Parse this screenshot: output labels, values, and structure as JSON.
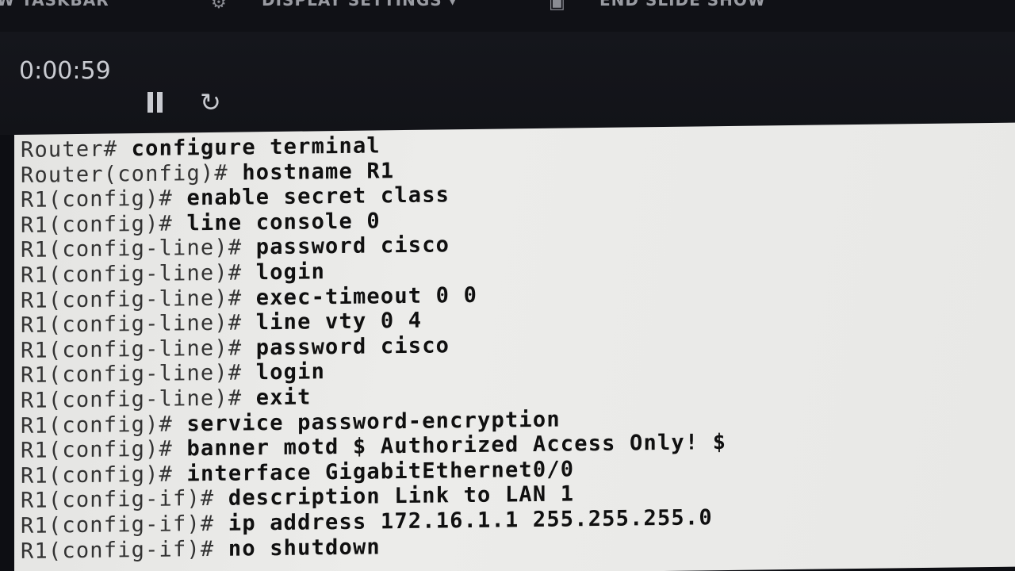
{
  "toolbar": {
    "items": [
      {
        "label": "W TASKBAR"
      },
      {
        "label": "DISPLAY SETTINGS ▾"
      },
      {
        "label": "END SLIDE SHOW"
      }
    ]
  },
  "presenter": {
    "timer": "0:00:59",
    "pause_icon": "pause-icon",
    "reset_icon": "↻"
  },
  "terminal": {
    "lines": [
      {
        "prompt": "Router#",
        "command": "configure terminal"
      },
      {
        "prompt": "Router(config)#",
        "command": "hostname R1"
      },
      {
        "prompt": "R1(config)#",
        "command": "enable secret class"
      },
      {
        "prompt": "R1(config)#",
        "command": "line console 0"
      },
      {
        "prompt": "R1(config-line)#",
        "command": "password cisco"
      },
      {
        "prompt": "R1(config-line)#",
        "command": "login"
      },
      {
        "prompt": "R1(config-line)#",
        "command": "exec-timeout 0 0"
      },
      {
        "prompt": "R1(config-line)#",
        "command": "line vty 0 4"
      },
      {
        "prompt": "R1(config-line)#",
        "command": "password cisco"
      },
      {
        "prompt": "R1(config-line)#",
        "command": "login"
      },
      {
        "prompt": "R1(config-line)#",
        "command": "exit"
      },
      {
        "prompt": "R1(config)#",
        "command": "service password-encryption"
      },
      {
        "prompt": "R1(config)#",
        "command": "banner motd $ Authorized Access Only! $"
      },
      {
        "prompt": "R1(config)#",
        "command": "interface GigabitEthernet0/0"
      },
      {
        "prompt": "R1(config-if)#",
        "command": "description Link to LAN 1"
      },
      {
        "prompt": "R1(config-if)#",
        "command": "ip address 172.16.1.1 255.255.255.0"
      },
      {
        "prompt": "R1(config-if)#",
        "command": "no shutdown"
      }
    ]
  }
}
